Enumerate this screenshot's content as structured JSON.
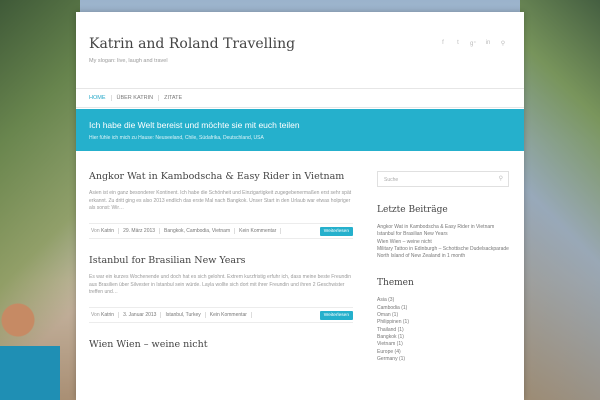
{
  "site": {
    "title": "Katrin and Roland Travelling",
    "tagline": "My slogan: live, laugh and travel"
  },
  "social_icons": [
    "facebook-icon",
    "twitter-icon",
    "google-plus-icon",
    "linkedin-icon",
    "search-icon"
  ],
  "nav": {
    "items": [
      {
        "label": "HOME",
        "active": true
      },
      {
        "label": "ÜBER KATRIN",
        "active": false
      },
      {
        "label": "ZITATE",
        "active": false
      }
    ]
  },
  "banner": {
    "title": "Ich habe die Welt bereist und möchte sie mit euch teilen",
    "subtitle": "Hier fühle ich mich zu Hause: Neuseeland, Chile, Südafrika, Deutschland, USA"
  },
  "posts": [
    {
      "title": "Angkor Wat in Kambodscha & Easy Rider in Vietnam",
      "excerpt": "Asien ist ein ganz besonderer Kontinent. Ich habe die Schönheit und Einzigartigkeit zugegebenermaßen erst sehr spät erkannt. Zu dritt ging es also 2013 endlich das erste Mal nach Bangkok. Unser Start in den Urlaub war etwas holpriger als sonst: Wir…",
      "meta_by": "Von",
      "author": "Katrin",
      "date": "29. März 2013",
      "categories": "Bangkok, Cambodia, Vietnam",
      "comments": "Kein Kommentar",
      "read_more": "Weiterlesen"
    },
    {
      "title": "Istanbul for Brasilian New Years",
      "excerpt": "Es war ein kurzes Wochenende und doch hat es sich gelohnt. Extrem kurzfristig erfuhr ich, dass meine beste Freundin aus Brasilien über Silvester in Istanbul sein würde. Layla wollte sich dort mit ihrer Freundin und ihren 2 Geschwister treffen und…",
      "meta_by": "Von",
      "author": "Katrin",
      "date": "3. Januar 2013",
      "categories": "Istanbul, Turkey",
      "comments": "Kein Kommentar",
      "read_more": "Weiterlesen"
    },
    {
      "title": "Wien Wien – weine nicht"
    }
  ],
  "sidebar": {
    "search_placeholder": "Suche",
    "recent_title": "Letzte Beiträge",
    "recent_posts": [
      "Angkor Wat in Kambodscha & Easy Rider in Vietnam",
      "Istanbul for Brasilian New Years",
      "Wien Wien – weine nicht",
      "Military Tattoo in Edinburgh – Schottische Dudelsackparade",
      "North Island of New Zealand in 1 month"
    ],
    "themes_title": "Themen",
    "themes": [
      "Asia (3)",
      "Cambodia (1)",
      "Oman (1)",
      "Philippinen (1)",
      "Thailand (1)",
      "Bangkok (1)",
      "Vietnam (1)",
      "Europe (4)",
      "Germany (1)"
    ]
  },
  "colors": {
    "accent": "#25b0cc",
    "text": "#444444",
    "muted": "#999999"
  }
}
